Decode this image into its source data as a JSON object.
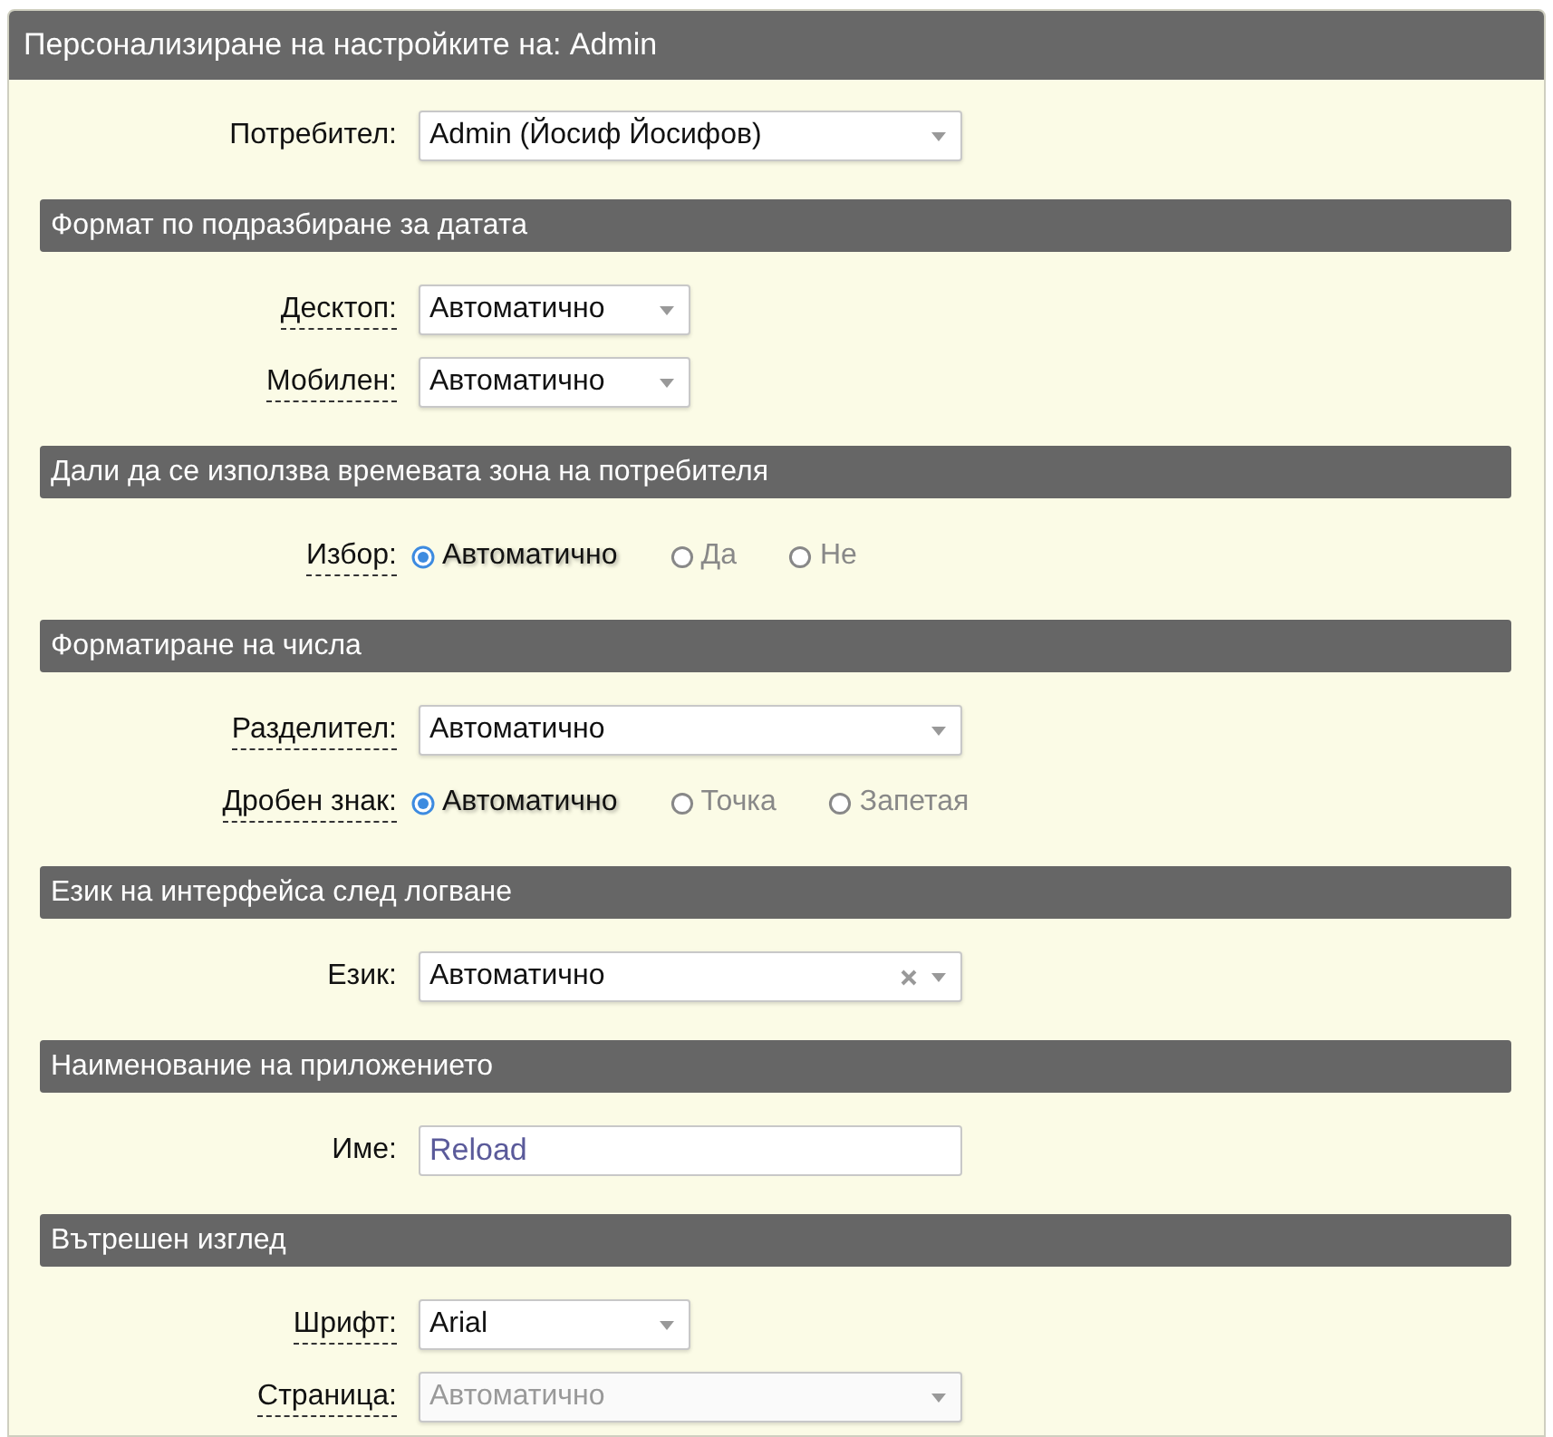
{
  "title": "Персонализиране на настройките на: Admin",
  "top_fields": [
    {
      "label": "Потребител:",
      "hint": false,
      "kind": "dropdown",
      "value": "Admin (Йосиф Йосифов)",
      "disabled": false
    }
  ],
  "sections": [
    {
      "title": "Формат по подразбиране за датата",
      "fields": [
        {
          "label": "Десктоп:",
          "hint": true,
          "kind": "compact-dropdown",
          "value": "Автоматично",
          "disabled": false
        },
        {
          "label": "Мобилен:",
          "hint": true,
          "kind": "compact-dropdown",
          "value": "Автоматично",
          "disabled": false
        }
      ]
    },
    {
      "title": "Дали да се използва времевата зона на потребителя",
      "fields": [
        {
          "label": "Избор:",
          "hint": true,
          "kind": "radio",
          "options": [
            {
              "label": "Автоматично",
              "selected": true
            },
            {
              "label": "Да",
              "selected": false
            },
            {
              "label": "Не",
              "selected": false
            }
          ]
        }
      ]
    },
    {
      "title": "Форматиране на числа",
      "fields": [
        {
          "label": "Разделител:",
          "hint": true,
          "kind": "dropdown",
          "value": "Автоматично",
          "disabled": false
        },
        {
          "label": "Дробен знак:",
          "hint": true,
          "kind": "radio",
          "options": [
            {
              "label": "Автоматично",
              "selected": true
            },
            {
              "label": "Точка",
              "selected": false
            },
            {
              "label": "Запетая",
              "selected": false
            }
          ]
        }
      ]
    },
    {
      "title": "Език на интерфейса след логване",
      "fields": [
        {
          "label": "Език:",
          "hint": false,
          "kind": "dropdown",
          "value": "Автоматично",
          "disabled": false,
          "clearable": true
        }
      ]
    },
    {
      "title": "Наименование на приложението",
      "fields": [
        {
          "label": "Име:",
          "hint": false,
          "kind": "text",
          "value": "Reload"
        }
      ]
    },
    {
      "title": "Вътрешен изглед",
      "fields": [
        {
          "label": "Шрифт:",
          "hint": true,
          "kind": "compact-dropdown",
          "value": "Arial",
          "disabled": false
        },
        {
          "label": "Страница:",
          "hint": true,
          "kind": "dropdown",
          "value": "Автоматично",
          "disabled": true
        }
      ]
    }
  ]
}
